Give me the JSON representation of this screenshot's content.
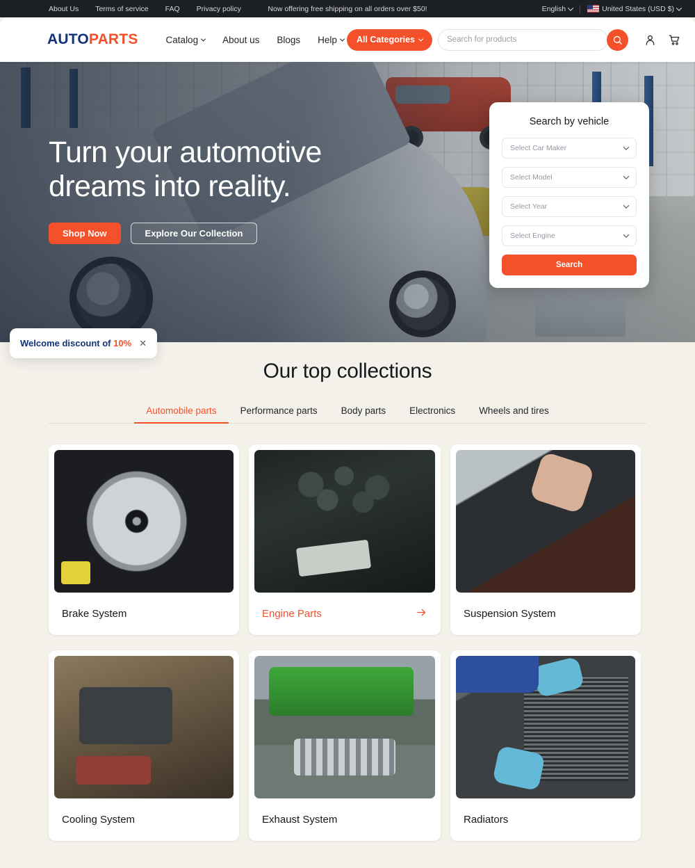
{
  "announcement": {
    "links": [
      "About Us",
      "Terms of service",
      "FAQ",
      "Privacy policy"
    ],
    "message": "Now offering free shipping on all orders over $50!",
    "language": "English",
    "country": "United States (USD $)",
    "flag_icon": "us-flag-icon"
  },
  "header": {
    "logo_primary": "AUTO",
    "logo_accent": "PARTS",
    "nav": [
      {
        "label": "Catalog",
        "has_caret": true
      },
      {
        "label": "About us",
        "has_caret": false
      },
      {
        "label": "Blogs",
        "has_caret": false
      },
      {
        "label": "Help",
        "has_caret": true
      }
    ],
    "categories_label": "All Categories",
    "search_placeholder": "Search for products",
    "search_value": "",
    "account_icon": "user-account-icon",
    "cart_icon": "shopping-cart-icon",
    "search_icon": "search-icon"
  },
  "hero": {
    "heading_line1": "Turn your automotive",
    "heading_line2": "dreams into reality.",
    "primary_button": "Shop Now",
    "secondary_button": "Explore Our Collection"
  },
  "vehicle_search": {
    "title": "Search by vehicle",
    "selects": [
      {
        "placeholder": "Select Car Maker"
      },
      {
        "placeholder": "Select Model"
      },
      {
        "placeholder": "Select Year"
      },
      {
        "placeholder": "Select Engine"
      }
    ],
    "button": "Search"
  },
  "toast": {
    "text": "Welcome discount of",
    "percent": "10%",
    "close_icon": "close-icon"
  },
  "collections": {
    "title": "Our top collections",
    "tabs": [
      {
        "label": "Automobile parts",
        "active": true
      },
      {
        "label": "Performance parts",
        "active": false
      },
      {
        "label": "Body parts",
        "active": false
      },
      {
        "label": "Electronics",
        "active": false
      },
      {
        "label": "Wheels and tires",
        "active": false
      }
    ],
    "cards": [
      {
        "label": "Brake System",
        "hovered": false,
        "art": "brake"
      },
      {
        "label": "Engine Parts",
        "hovered": true,
        "art": "engine"
      },
      {
        "label": "Suspension System",
        "hovered": false,
        "art": "suspension"
      },
      {
        "label": "Cooling System",
        "hovered": false,
        "art": "cooling"
      },
      {
        "label": "Exhaust System",
        "hovered": false,
        "art": "exhaust"
      },
      {
        "label": "Radiators",
        "hovered": false,
        "art": "radiator"
      }
    ],
    "arrow_icon": "arrow-right-icon"
  },
  "colors": {
    "accent": "#f4502a",
    "navy": "#12337a",
    "page_bg": "#f4f1eb",
    "topbar_bg": "#1c1f24"
  }
}
